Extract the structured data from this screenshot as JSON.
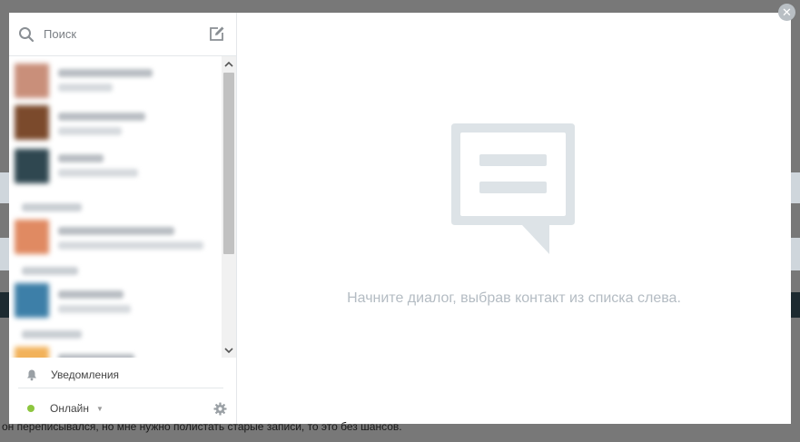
{
  "search": {
    "placeholder": "Поиск"
  },
  "sidebar": {
    "notifications_label": "Уведомления",
    "status_label": "Онлайн",
    "status_color": "#8dc63f"
  },
  "contacts": [
    {
      "avatar_color": "#c98f7a"
    },
    {
      "avatar_color": "#7b4a2c"
    },
    {
      "avatar_color": "#2f4750"
    },
    {
      "avatar_color": "#e08a62"
    },
    {
      "avatar_color": "#3d7fa8"
    },
    {
      "avatar_color": "#f2b25a"
    }
  ],
  "main": {
    "empty_message": "Начните диалог, выбрав контакт из списка слева."
  },
  "background": {
    "text": "он переписывался, но мне нужно полистать старые записи, то это без шансов."
  },
  "icons": {
    "search": "search-icon",
    "compose": "compose-icon",
    "bell": "bell-icon",
    "gear": "gear-icon",
    "close": "close-icon",
    "chat_bubble": "chat-bubble-icon"
  },
  "colors": {
    "accent_gray": "#dde3e7",
    "empty_text": "#b4bcc3",
    "online": "#8dc63f"
  }
}
